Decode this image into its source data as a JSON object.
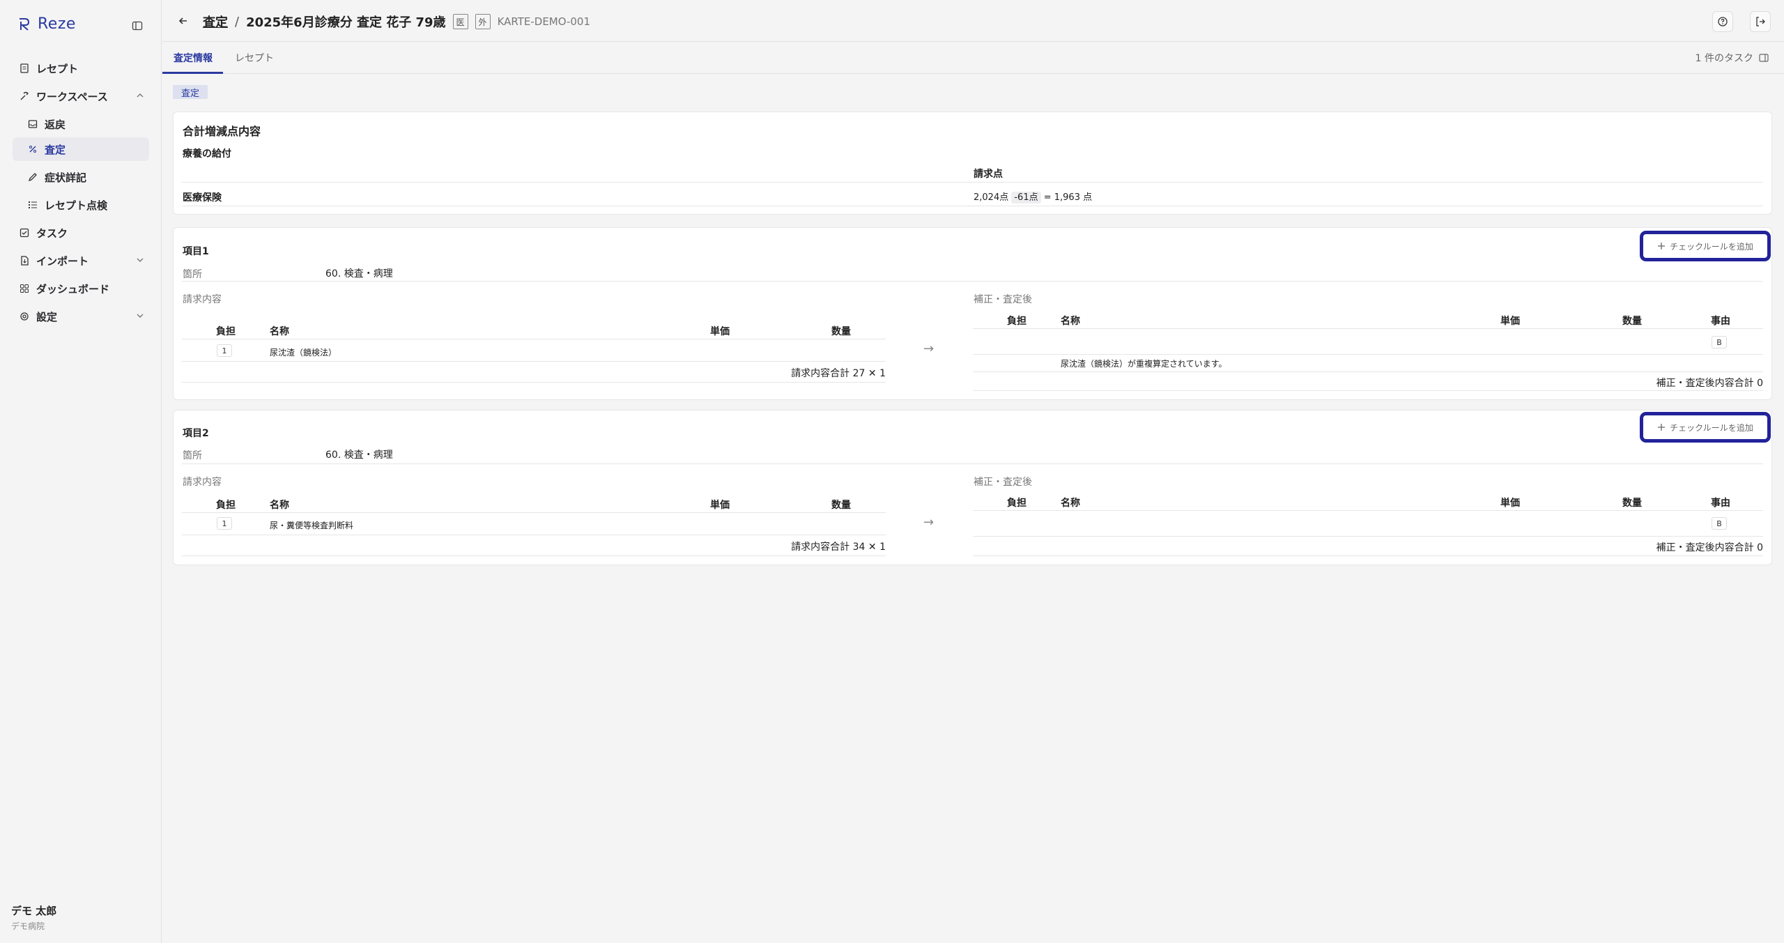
{
  "app": {
    "name": "Reze"
  },
  "sidebar": {
    "items": [
      {
        "label": "レセプト"
      },
      {
        "label": "ワークスペース"
      },
      {
        "label": "返戻"
      },
      {
        "label": "査定"
      },
      {
        "label": "症状詳記"
      },
      {
        "label": "レセプト点検"
      },
      {
        "label": "タスク"
      },
      {
        "label": "インポート"
      },
      {
        "label": "ダッシュボード"
      },
      {
        "label": "設定"
      }
    ],
    "user": {
      "name": "デモ 太郎",
      "org": "デモ病院"
    }
  },
  "header": {
    "crumb_link": "査定",
    "separator": "/",
    "title": "2025年6月診療分 査定 花子 79歳",
    "tag1": "医",
    "tag2": "外",
    "karte_id": "KARTE-DEMO-001"
  },
  "tabs": [
    {
      "label": "査定情報"
    },
    {
      "label": "レセプト"
    }
  ],
  "task_count": "1 件のタスク",
  "badge": "査定",
  "summary": {
    "title": "合計増減点内容",
    "section": "療養の給付",
    "col_header": "請求点",
    "row_label": "医療保険",
    "billed": "2,024点",
    "delta": "-61点",
    "result": "= 1,963 点"
  },
  "items": [
    {
      "title": "項目1",
      "location_label": "箇所",
      "location_value": "60. 検査・病理",
      "add_rule": "チェックルールを追加",
      "claim_label": "請求内容",
      "after_label": "補正・査定後",
      "claim_headers": {
        "burden": "負担",
        "name": "名称",
        "unit": "単価",
        "qty": "数量"
      },
      "after_headers": {
        "burden": "負担",
        "name": "名称",
        "unit": "単価",
        "qty": "数量",
        "reason": "事由"
      },
      "claim_row": {
        "burden": "1",
        "name": "尿沈渣（鏡検法）"
      },
      "claim_total": "請求内容合計 27 ✕ 1",
      "after_reason": "B",
      "after_note": "尿沈渣（鏡検法）が重複算定されています。",
      "after_total": "補正・査定後内容合計 0"
    },
    {
      "title": "項目2",
      "location_label": "箇所",
      "location_value": "60. 検査・病理",
      "add_rule": "チェックルールを追加",
      "claim_label": "請求内容",
      "after_label": "補正・査定後",
      "claim_headers": {
        "burden": "負担",
        "name": "名称",
        "unit": "単価",
        "qty": "数量"
      },
      "after_headers": {
        "burden": "負担",
        "name": "名称",
        "unit": "単価",
        "qty": "数量",
        "reason": "事由"
      },
      "claim_row": {
        "burden": "1",
        "name": "尿・糞便等検査判断料"
      },
      "claim_total": "請求内容合計 34 ✕ 1",
      "after_reason": "B",
      "after_total": "補正・査定後内容合計 0"
    }
  ]
}
